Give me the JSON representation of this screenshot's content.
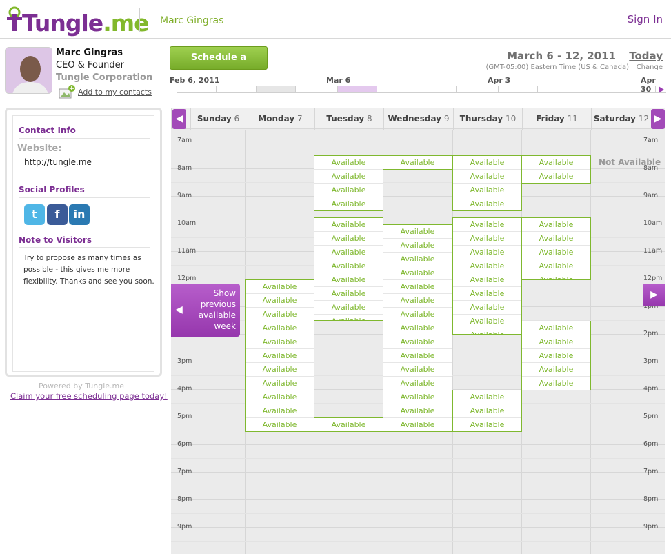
{
  "header": {
    "brand_prefix": "Tungle",
    "brand_suffix": ".me",
    "owner_name": "Marc Gingras",
    "sign_in": "Sign In"
  },
  "profile": {
    "name": "Marc Gingras",
    "title": "CEO & Founder",
    "company": "Tungle Corporation",
    "add_contact": "Add to my contacts"
  },
  "sidebar": {
    "contact_heading": "Contact Info",
    "website_label": "Website:",
    "website_value": "http://tungle.me",
    "social_heading": "Social Profiles",
    "social_icons": [
      "twitter-icon",
      "facebook-icon",
      "linkedin-icon"
    ],
    "note_heading": "Note to Visitors",
    "note_text": "Try to propose as many times as possible - this gives me more flexibility. Thanks and see you soon.",
    "powered_by": "Powered by Tungle.me",
    "claim_link": "Claim your free scheduling page today!"
  },
  "toolbar": {
    "schedule_button": "Schedule a meeting",
    "date_range": "March 6 - 12, 2011",
    "today": "Today",
    "timezone": "(GMT-05:00) Eastern Time (US & Canada)",
    "change": "Change"
  },
  "timeline": {
    "labels": [
      "Feb 6, 2011",
      "Mar 6",
      "Apr 3",
      "Apr 30"
    ]
  },
  "calendar": {
    "days": [
      {
        "name": "Sunday",
        "num": "6"
      },
      {
        "name": "Monday",
        "num": "7"
      },
      {
        "name": "Tuesday",
        "num": "8"
      },
      {
        "name": "Wednesday",
        "num": "9"
      },
      {
        "name": "Thursday",
        "num": "10"
      },
      {
        "name": "Friday",
        "num": "11"
      },
      {
        "name": "Saturday",
        "num": "12"
      }
    ],
    "hours_left": [
      "7am",
      "8am",
      "9am",
      "10am",
      "11am",
      "12pm",
      "1pm",
      "2pm",
      "3pm",
      "4pm",
      "5pm",
      "6pm",
      "7pm",
      "8pm",
      "9pm"
    ],
    "hours_right": [
      "7am",
      "8am",
      "9am",
      "10am",
      "11am",
      "12pm",
      "1pm",
      "2pm",
      "3pm",
      "4pm",
      "5pm",
      "6pm",
      "7pm",
      "8pm",
      "9pm"
    ],
    "slot_label": "Available",
    "not_available": "Not Available",
    "show_previous": "Show previous available week"
  },
  "colors": {
    "brand_purple": "#7c2f93",
    "brand_green": "#82b82c",
    "available_green": "#7fb82f"
  }
}
